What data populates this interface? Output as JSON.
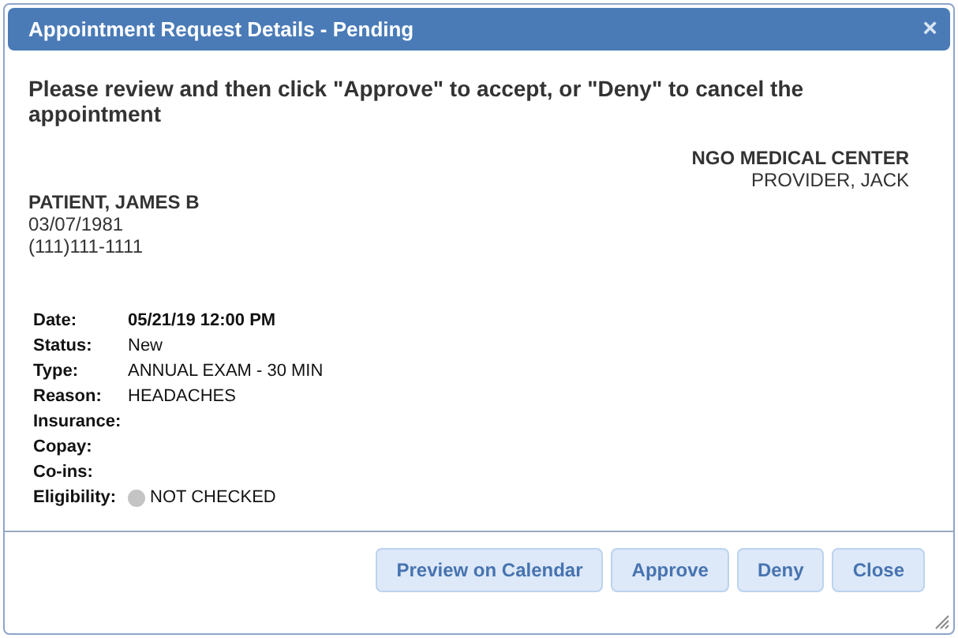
{
  "window": {
    "title": "Appointment Request Details - Pending",
    "close": "×"
  },
  "instructions": "Please review and then click \"Approve\" to accept, or \"Deny\" to cancel the appointment",
  "provider": {
    "facility": "NGO MEDICAL CENTER",
    "name": "PROVIDER, JACK"
  },
  "patient": {
    "name": "PATIENT, JAMES B",
    "dob": "03/07/1981",
    "phone": "(111)111-1111"
  },
  "details": [
    {
      "label": "Date:",
      "kind": "text",
      "emphasis": true,
      "value": "05/21/19 12:00 PM"
    },
    {
      "label": "Status:",
      "kind": "text",
      "emphasis": false,
      "value": "New"
    },
    {
      "label": "Type:",
      "kind": "text",
      "emphasis": false,
      "value": "ANNUAL EXAM - 30 MIN"
    },
    {
      "label": "Reason:",
      "kind": "text",
      "emphasis": false,
      "value": "HEADACHES"
    },
    {
      "label": "Insurance:",
      "kind": "empty"
    },
    {
      "label": "Copay:",
      "kind": "empty"
    },
    {
      "label": "Co-ins:",
      "kind": "empty"
    },
    {
      "label": "Eligibility:",
      "kind": "status",
      "color": "#c4c4c4",
      "value": "NOT CHECKED"
    }
  ],
  "buttons": [
    "Preview on Calendar",
    "Approve",
    "Deny",
    "Close"
  ]
}
